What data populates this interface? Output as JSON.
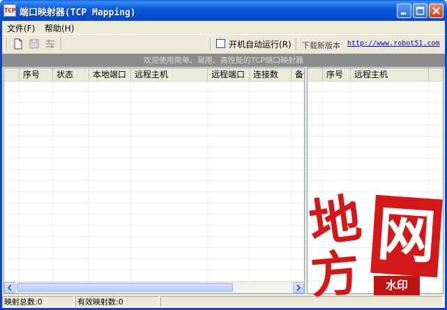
{
  "window": {
    "title": "端口映射器(TCP Mapping)",
    "icon_text": "TCP"
  },
  "menu": [
    {
      "label": "文件(F)"
    },
    {
      "label": "帮助(H)"
    }
  ],
  "toolbar": {
    "icons": [
      "new-file-icon",
      "save-icon",
      "settings-icon"
    ],
    "autorun_label": "开机自动运行(R)",
    "autorun_checked": false,
    "download_label": "下载新版本",
    "download_link": "http://www.robot51.com"
  },
  "banner": {
    "text": "欢迎使用简单、易用、高性能的TCP端口映射器"
  },
  "left_table": {
    "columns": [
      "序号",
      "状态",
      "本地端口",
      "远程主机",
      "远程端口",
      "连接数",
      "备注"
    ],
    "rows": []
  },
  "right_table": {
    "columns": [
      "序号",
      "远程主机"
    ],
    "rows": []
  },
  "statusbar": {
    "total_mappings": "映射总数:0",
    "valid_mappings": "有效映射数:0"
  },
  "watermark": {
    "text": "地方网",
    "seal": "水印"
  }
}
